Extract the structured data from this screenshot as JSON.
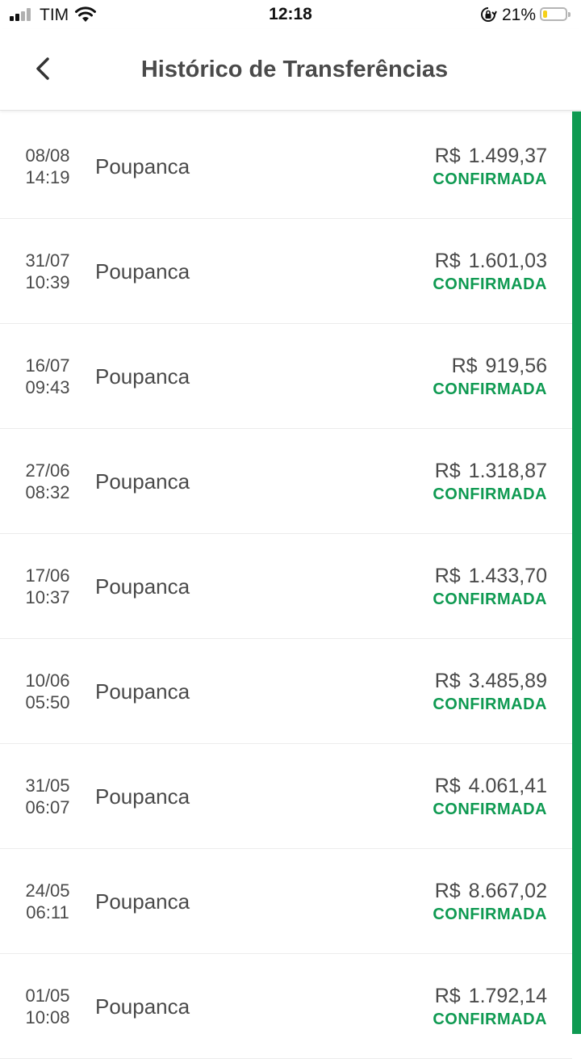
{
  "status_bar": {
    "carrier": "TIM",
    "time": "12:18",
    "battery_percent": "21%",
    "battery_level": 0.21,
    "battery_color": "#f5d11b",
    "signal_icon": "cellular-signal-icon",
    "wifi_icon": "wifi-icon",
    "lock_icon": "orientation-lock-icon"
  },
  "header": {
    "title": "Histórico de Transferências",
    "back_icon": "chevron-left-icon"
  },
  "colors": {
    "accent": "#0f9a52",
    "text": "#4a4a4a"
  },
  "transfers": [
    {
      "date": "08/08",
      "time": "14:19",
      "description": "Poupanca",
      "currency": "R$",
      "amount": "1.499,37",
      "status": "CONFIRMADA"
    },
    {
      "date": "31/07",
      "time": "10:39",
      "description": "Poupanca",
      "currency": "R$",
      "amount": "1.601,03",
      "status": "CONFIRMADA"
    },
    {
      "date": "16/07",
      "time": "09:43",
      "description": "Poupanca",
      "currency": "R$",
      "amount": "919,56",
      "status": "CONFIRMADA"
    },
    {
      "date": "27/06",
      "time": "08:32",
      "description": "Poupanca",
      "currency": "R$",
      "amount": "1.318,87",
      "status": "CONFIRMADA"
    },
    {
      "date": "17/06",
      "time": "10:37",
      "description": "Poupanca",
      "currency": "R$",
      "amount": "1.433,70",
      "status": "CONFIRMADA"
    },
    {
      "date": "10/06",
      "time": "05:50",
      "description": "Poupanca",
      "currency": "R$",
      "amount": "3.485,89",
      "status": "CONFIRMADA"
    },
    {
      "date": "31/05",
      "time": "06:07",
      "description": "Poupanca",
      "currency": "R$",
      "amount": "4.061,41",
      "status": "CONFIRMADA"
    },
    {
      "date": "24/05",
      "time": "06:11",
      "description": "Poupanca",
      "currency": "R$",
      "amount": "8.667,02",
      "status": "CONFIRMADA"
    },
    {
      "date": "01/05",
      "time": "10:08",
      "description": "Poupanca",
      "currency": "R$",
      "amount": "1.792,14",
      "status": "CONFIRMADA"
    }
  ]
}
